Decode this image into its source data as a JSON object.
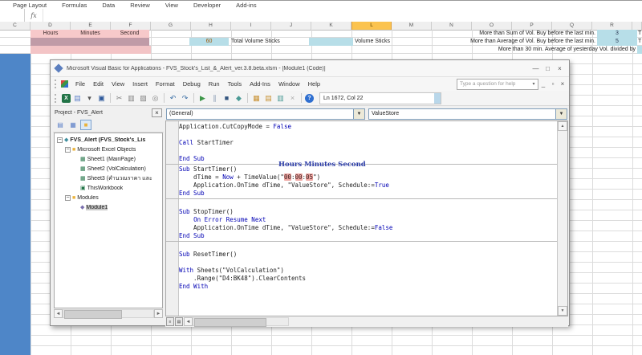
{
  "excel": {
    "ribbon_tabs": [
      "Page Layout",
      "Formulas",
      "Data",
      "Review",
      "View",
      "Developer",
      "Add-ins"
    ],
    "formula_bar": {
      "fx_label": "fx"
    },
    "columns": {
      "headers": [
        "C",
        "D",
        "E",
        "F",
        "G",
        "H",
        "I",
        "J",
        "K",
        "L",
        "M",
        "N",
        "O",
        "P",
        "Q",
        "R"
      ],
      "selected": "L"
    },
    "cells": {
      "hours": "Hours",
      "minutes": "Minutes",
      "second": "Second",
      "total_sticks_value": "60",
      "total_sticks_label": "Total Volume Sticks",
      "volume_sticks_label": "Volume Sticks",
      "note1": "More than Sum of Vol. Buy before the last min.",
      "note1_value": "3",
      "note2": "More than Average of Vol. Buy before the last min.",
      "note2_value": "5",
      "note3": "More than 30 min. Average of yesterday Vol. divided by",
      "edge1": "T",
      "edge2": "T"
    }
  },
  "vba": {
    "title": "Microsoft Visual Basic for Applications - FVS_Stock's_List_&_Alert_ver.3.8.beta.xlsm - [Module1 (Code)]",
    "window_buttons": {
      "minimize": "—",
      "maximize": "□",
      "close": "×"
    },
    "mdi_buttons": {
      "minimize": "_",
      "restore": "▫",
      "close": "×"
    },
    "menus": [
      "File",
      "Edit",
      "View",
      "Insert",
      "Format",
      "Debug",
      "Run",
      "Tools",
      "Add-Ins",
      "Window",
      "Help"
    ],
    "help_box": {
      "text": "Type a question for help",
      "caret": "▾"
    },
    "toolbar": {
      "status": "Ln 1672, Col 22",
      "icons": [
        {
          "name": "view-excel-button",
          "glyph": "X",
          "color": "#ffffff",
          "bg": "#217346"
        },
        {
          "name": "insert-userform-button",
          "glyph": "▤",
          "color": "#5b7fc7"
        },
        {
          "name": "insert-userform-caret",
          "glyph": "▾",
          "color": "#555555"
        },
        {
          "name": "save-button",
          "glyph": "▣",
          "color": "#2b579a"
        },
        {
          "sep": true
        },
        {
          "name": "cut-button",
          "glyph": "✂",
          "color": "#808080"
        },
        {
          "name": "copy-button",
          "glyph": "▥",
          "color": "#808080"
        },
        {
          "name": "paste-button",
          "glyph": "▨",
          "color": "#808080"
        },
        {
          "name": "find-button",
          "glyph": "◎",
          "color": "#808080"
        },
        {
          "sep": true
        },
        {
          "name": "undo-button",
          "glyph": "↶",
          "color": "#3a6ea5"
        },
        {
          "name": "redo-button",
          "glyph": "↷",
          "color": "#3a6ea5"
        },
        {
          "sep": true
        },
        {
          "name": "run-button",
          "glyph": "▶",
          "color": "#3c9647"
        },
        {
          "name": "break-button",
          "glyph": "∥",
          "color": "#8a9bb5"
        },
        {
          "name": "reset-button",
          "glyph": "■",
          "color": "#33557f"
        },
        {
          "name": "design-mode-button",
          "glyph": "◆",
          "color": "#4a9a95"
        },
        {
          "sep": true
        },
        {
          "name": "project-explorer-button",
          "glyph": "▦",
          "color": "#c78f2f"
        },
        {
          "name": "properties-window-button",
          "glyph": "▤",
          "color": "#c78f2f"
        },
        {
          "name": "object-browser-button",
          "glyph": "▥",
          "color": "#4a9a95"
        },
        {
          "name": "toolbox-button",
          "glyph": "×",
          "color": "#aaaaaa"
        },
        {
          "sep": true
        },
        {
          "name": "help-button",
          "glyph": "?",
          "color": "#ffffff",
          "bg": "#2f6fd0",
          "round": true
        }
      ]
    },
    "project": {
      "header": "Project - FVS_Alert",
      "close": "×",
      "tools": [
        {
          "name": "view-code-button",
          "glyph": "▤",
          "color": "#5b7fc7"
        },
        {
          "name": "view-object-button",
          "glyph": "▦",
          "color": "#5b7fc7"
        },
        {
          "name": "toggle-folders-button",
          "glyph": "■",
          "color": "#ebb33c",
          "active": true
        }
      ],
      "tree": [
        {
          "indent": 0,
          "expand": true,
          "icon": "project-icon",
          "glyph": "◆",
          "color": "#3e8e9e",
          "label": "FVS_Alert (FVS_Stock's_Lis",
          "bold": true
        },
        {
          "indent": 1,
          "expand": true,
          "icon": "folder-icon",
          "glyph": "■",
          "color": "#ebb33c",
          "label": "Microsoft Excel Objects"
        },
        {
          "indent": 2,
          "icon": "sheet-icon",
          "glyph": "▦",
          "color": "#217346",
          "label": "Sheet1 (MainPage)"
        },
        {
          "indent": 2,
          "icon": "sheet-icon",
          "glyph": "▦",
          "color": "#217346",
          "label": "Sheet2 (VolCalculation)"
        },
        {
          "indent": 2,
          "icon": "sheet-icon",
          "glyph": "▦",
          "color": "#217346",
          "label": "Sheet3 (คำนวณราคา และ"
        },
        {
          "indent": 2,
          "icon": "workbook-icon",
          "glyph": "▣",
          "color": "#217346",
          "label": "ThisWorkbook"
        },
        {
          "indent": 1,
          "expand": true,
          "icon": "folder-icon",
          "glyph": "■",
          "color": "#ebb33c",
          "label": "Modules"
        },
        {
          "indent": 2,
          "icon": "module-icon",
          "glyph": "◆",
          "color": "#7a6fae",
          "label": "Module1",
          "selected": true
        }
      ]
    },
    "code": {
      "left_combo": "(General)",
      "right_combo": "ValueStore",
      "annotation": "Hours Minutes Second",
      "lines": [
        {
          "tk": [
            [
              "n",
              "Application.CutCopyMode = "
            ],
            [
              "k",
              "False"
            ]
          ]
        },
        {
          "tk": []
        },
        {
          "tk": [
            [
              "k",
              "Call"
            ],
            [
              "n",
              " StartTimer"
            ]
          ]
        },
        {
          "tk": []
        },
        {
          "tk": [
            [
              "k",
              "End Sub"
            ]
          ]
        },
        {
          "sep": true
        },
        {
          "tk": [
            [
              "k",
              "Sub"
            ],
            [
              "n",
              " StartTimer()"
            ]
          ]
        },
        {
          "tk": [
            [
              "n",
              "    dTime = "
            ],
            [
              "k",
              "Now"
            ],
            [
              "n",
              " + TimeValue(\""
            ],
            [
              "h",
              "00"
            ],
            [
              "n",
              ":"
            ],
            [
              "h",
              "00"
            ],
            [
              "n",
              ":"
            ],
            [
              "h",
              "05"
            ],
            [
              "n",
              "\")"
            ]
          ]
        },
        {
          "tk": [
            [
              "n",
              "    Application.OnTime dTime, \"ValueStore\", Schedule:="
            ],
            [
              "k",
              "True"
            ]
          ]
        },
        {
          "tk": [
            [
              "k",
              "End Sub"
            ]
          ]
        },
        {
          "sep": true
        },
        {
          "tk": []
        },
        {
          "tk": [
            [
              "k",
              "Sub"
            ],
            [
              "n",
              " StopTimer()"
            ]
          ]
        },
        {
          "tk": [
            [
              "n",
              "    "
            ],
            [
              "k",
              "On Error Resume Next"
            ]
          ]
        },
        {
          "tk": [
            [
              "n",
              "    Application.OnTime dTime, \"ValueStore\", Schedule:="
            ],
            [
              "k",
              "False"
            ]
          ]
        },
        {
          "tk": [
            [
              "k",
              "End Sub"
            ]
          ]
        },
        {
          "sep": true
        },
        {
          "tk": []
        },
        {
          "tk": [
            [
              "k",
              "Sub"
            ],
            [
              "n",
              " ResetTimer()"
            ]
          ]
        },
        {
          "tk": []
        },
        {
          "tk": [
            [
              "k",
              "With"
            ],
            [
              "n",
              " Sheets(\"VolCalculation\")"
            ]
          ]
        },
        {
          "tk": [
            [
              "n",
              "    .Range(\"D4:BK48\").ClearContents"
            ]
          ]
        },
        {
          "tk": [
            [
              "k",
              "End With"
            ]
          ]
        }
      ]
    }
  },
  "colors": {
    "blue_column": "#4e86c8",
    "selected_column_header": "#fbc34f",
    "cell_fill_blue": "#b7dee8",
    "annotation_pink": "#f7c9ca",
    "annotation_pink_dark": "#c09ba7",
    "code_keyword": "#0000b4",
    "code_highlight": "#f0a8a4",
    "annotation_text": "#2b3ca8"
  }
}
